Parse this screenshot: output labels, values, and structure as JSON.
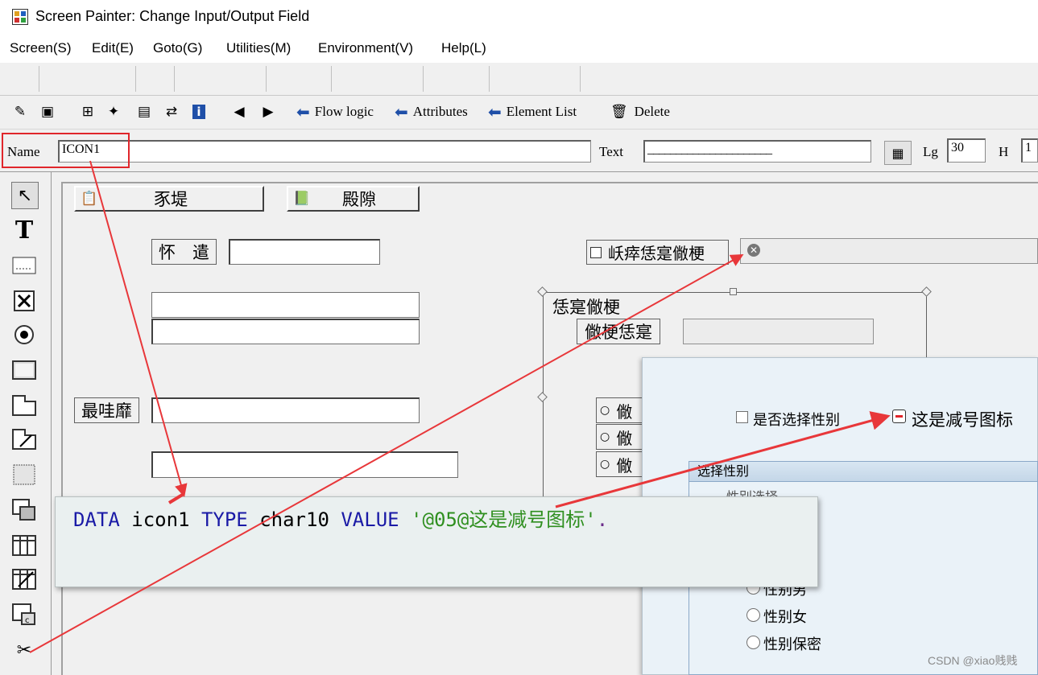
{
  "window": {
    "title": "Screen Painter:  Change Input/Output Field"
  },
  "menu": [
    "Screen(S)",
    "Edit(E)",
    "Goto(G)",
    "Utilities(M)",
    "Environment(V)",
    "Help(L)"
  ],
  "toolbar": {
    "flow_logic": "Flow logic",
    "attributes": "Attributes",
    "element_list": "Element List",
    "delete": "Delete"
  },
  "element_row": {
    "name_label": "Name",
    "name_value": "ICON1",
    "text_label": "Text",
    "text_value": "______________________",
    "lg_label": "Lg",
    "lg_value": "30",
    "h_label": "H",
    "h_value": "1"
  },
  "canvas": {
    "button1_label": "豕堤",
    "button2_label": "殿隙",
    "label1": "怀　遣",
    "label2": "最哇靡",
    "checkbox_label": "岆瘁恁寔僘梗",
    "frame_title": "恁寔僘梗",
    "frame_label": "僘梗恁寔",
    "radio_label": "僘"
  },
  "code": {
    "kw1": "DATA",
    "var": " icon1 ",
    "kw2": "TYPE",
    "type": " char10 ",
    "kw3": "VALUE",
    "string": " '@05@这是减号图标'",
    "end": "."
  },
  "preview": {
    "checkbox_label": "是否选择性别",
    "icon_text": "这是减号图标",
    "frame_title": "选择性别",
    "partial_text": "性别选择",
    "radio_male": "性别男",
    "radio_female": "性别女",
    "radio_secret": "性别保密"
  },
  "watermark": "CSDN @xiao贱贱",
  "colors": {
    "annotation_red": "#e8373a",
    "highlight_box": "#e0262b",
    "keyword_blue": "#1a1aa6",
    "string_green": "#2f8f1f"
  }
}
